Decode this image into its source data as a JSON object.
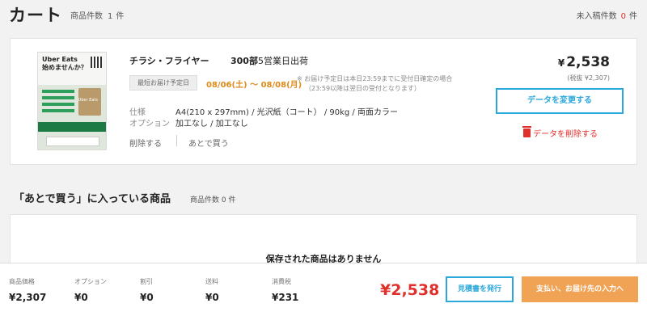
{
  "header": {
    "title": "カート",
    "item_count_label": "商品件数",
    "item_count": "1",
    "unit": "件",
    "unentered_label": "未入稿件数",
    "unentered_count": "0",
    "unentered_unit": "件"
  },
  "cart_item": {
    "thumbnail": {
      "brand": "Uber Eats",
      "headline": "始めませんか？",
      "bag_label": "Uber Eats"
    },
    "name": "チラシ・フライヤー",
    "quantity": "300部",
    "shipping": "5営業日出荷",
    "delivery_badge": "最短お届け予定日",
    "delivery_date": "08/06(土) 〜 08/08(月)",
    "notice_line1": "※ お届け予定日は本日23:59までに受付日確定の場合",
    "notice_line2": "（23:59以降は翌日の受付となります）",
    "spec_label": "仕様",
    "spec_value": "A4(210 x 297mm) / 光沢紙（コート） / 90kg / 両面カラー",
    "option_label": "オプション",
    "option_value": "加工なし / 加工なし",
    "delete_link": "削除する",
    "later_link": "あとで買う",
    "price_yen": "¥",
    "price": "2,538",
    "price_tax": "(税抜 ¥2,307)",
    "change_button": "データを変更する",
    "delete_data": "データを削除する"
  },
  "later_section": {
    "title": "「あとで買う」に入っている商品",
    "count_label": "商品件数",
    "count": "0",
    "unit": "件",
    "empty_message": "保存された商品はありません"
  },
  "footer": {
    "summary": [
      {
        "label": "商品価格",
        "value": "¥2,307"
      },
      {
        "label": "オプション",
        "value": "¥0"
      },
      {
        "label": "割引",
        "value": "¥0"
      },
      {
        "label": "送料",
        "value": "¥0"
      },
      {
        "label": "消費税",
        "value": "¥231"
      }
    ],
    "total": "¥2,538",
    "estimate_button": "見積書を発行",
    "checkout_button": "支払い、お届け先の入力へ"
  },
  "colors": {
    "accent_blue": "#2ba8db",
    "price_red": "#e0302b",
    "delivery_orange": "#e08a1a",
    "checkout_orange": "#f0a255"
  }
}
